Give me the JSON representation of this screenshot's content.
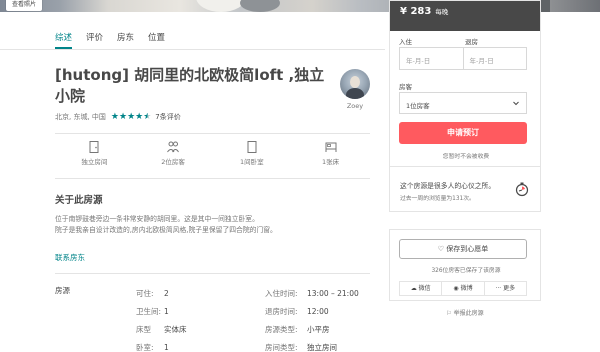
{
  "hero": {
    "photo_button": "查看照片"
  },
  "tabs": [
    {
      "label": "综述"
    },
    {
      "label": "评价"
    },
    {
      "label": "房东"
    },
    {
      "label": "位置"
    }
  ],
  "listing": {
    "title": "[hutong] 胡同里的北欧极简loft ,独立小院",
    "location": "北京, 东城, 中国",
    "rating": 4.5,
    "review_count": "7条评价",
    "host_name": "Zoey"
  },
  "amenities": [
    {
      "label": "独立房间",
      "icon": "door-icon"
    },
    {
      "label": "2位房客",
      "icon": "guests-icon"
    },
    {
      "label": "1间卧室",
      "icon": "bedroom-icon"
    },
    {
      "label": "1张床",
      "icon": "bed-icon"
    }
  ],
  "about": {
    "heading": "关于此房源",
    "line1": "位于南锣鼓巷旁边一条非常安静的胡同里。这是其中一间独立卧室。",
    "line2": "院子是我亲自设计改造的,房内北欧极简风格,院子里保留了四合院的门窗。",
    "contact": "联系房东"
  },
  "specs": {
    "heading": "房源",
    "col1": [
      {
        "k": "可住:",
        "v": "2"
      },
      {
        "k": "卫生间:",
        "v": "1"
      },
      {
        "k": "床型",
        "v": "实体床"
      },
      {
        "k": "卧室:",
        "v": "1"
      }
    ],
    "col2": [
      {
        "k": "入住时间:",
        "v": "13:00 – 21:00"
      },
      {
        "k": "退房时间:",
        "v": "12:00"
      },
      {
        "k": "房源类型:",
        "v": "小平房"
      },
      {
        "k": "房间类型:",
        "v": "独立房间"
      }
    ]
  },
  "booking": {
    "price": "¥ 283",
    "per_night": "每晚",
    "checkin_label": "入住",
    "checkout_label": "退房",
    "date_placeholder": "年-月-日",
    "guests_label": "房客",
    "guests_value": "1位房客",
    "book_button": "申请预订",
    "no_charge": "您暂时不会被收费",
    "rare_title": "这个房源是很多人的心仪之所。",
    "rare_sub": "过去一周的浏览量为131次。",
    "save_button": "保存到心愿单",
    "saved_note": "326位房客已保存了该房源",
    "share": [
      "微信",
      "微博",
      "更多"
    ],
    "report": "举报此房源"
  },
  "colors": {
    "accent": "#008489",
    "book": "#ff5a5f",
    "price_bar": "#484848"
  }
}
